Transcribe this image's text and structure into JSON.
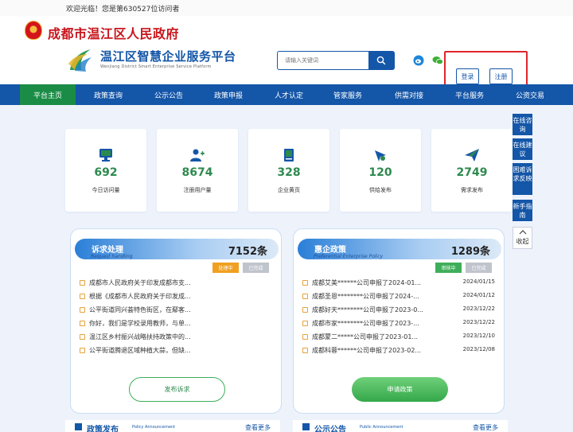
{
  "topbar": {
    "welcome": "欢迎光临！您是第630527位访问者"
  },
  "header": {
    "gov_title": "成都市温江区人民政府",
    "platform_title": "温江区智慧企业服务平台",
    "platform_subtitle": "Wenjiang District Smart Enterprise Service Platform",
    "search_placeholder": "请输入关键词",
    "login_label": "登录",
    "register_label": "注册"
  },
  "nav": {
    "items": [
      {
        "label": "平台主页"
      },
      {
        "label": "政策查询"
      },
      {
        "label": "公示公告"
      },
      {
        "label": "政策申报"
      },
      {
        "label": "人才认定"
      },
      {
        "label": "管家服务"
      },
      {
        "label": "供需对接"
      },
      {
        "label": "平台服务"
      },
      {
        "label": "公资交易"
      }
    ]
  },
  "side_tools": {
    "items": [
      {
        "label": "在线咨询"
      },
      {
        "label": "在线建议"
      },
      {
        "label": "困难诉求反映"
      },
      {
        "label": "新手指南"
      }
    ],
    "collapse_label": "收起"
  },
  "stats": [
    {
      "value": "692",
      "label": "今日访问量",
      "icon": "monitor-icon"
    },
    {
      "value": "8674",
      "label": "注册用户量",
      "icon": "add-user-icon"
    },
    {
      "value": "328",
      "label": "企业黄页",
      "icon": "book-icon"
    },
    {
      "value": "120",
      "label": "供给发布",
      "icon": "supply-icon"
    },
    {
      "value": "2749",
      "label": "需求发布",
      "icon": "paper-plane-icon"
    }
  ],
  "panels": {
    "appeals": {
      "title": "诉求处理",
      "subtitle": "Request handling",
      "count": "7152条",
      "tags": [
        "处理中",
        "已完成"
      ],
      "rows": [
        "成都市人民政府关于印发成都市支...",
        "根据《成都市人民政府关于印发成...",
        "公平街道同兴荟特色街区，在鄢客...",
        "你好，我们是学校录用教师，与单...",
        "温江区乡村振兴战略扶持政策中的...",
        "公平街道腾退区域种植大蒜，但缺..."
      ],
      "button_label": "发布诉求"
    },
    "policy": {
      "title": "惠企政策",
      "subtitle": "Preferential Enterprise Policy",
      "count": "1289条",
      "tags": [
        "审核中",
        "已完成"
      ],
      "rows": [
        {
          "text": "成都艾美******公司申报了2024-01...",
          "date": "2024/01/15"
        },
        {
          "text": "成都圣恩********公司申报了2024-...",
          "date": "2024/01/12"
        },
        {
          "text": "成都好天********公司申报了2023-0...",
          "date": "2023/12/22"
        },
        {
          "text": "成都市家********公司申报了2023-...",
          "date": "2023/12/22"
        },
        {
          "text": "成都蒙二*****公司申报了2023-01...",
          "date": "2023/12/10"
        },
        {
          "text": "成都科蓉******公司申报了2023-02...",
          "date": "2023/12/08"
        }
      ],
      "button_label": "申请政策"
    }
  },
  "bottom": {
    "left_title": "政策发布",
    "left_subtitle": "Policy Announcement",
    "left_more": "查看更多",
    "right_title": "公示公告",
    "right_subtitle": "Public Announcement",
    "right_more": "查看更多"
  },
  "colors": {
    "brand_blue": "#1456a8",
    "nav_active_green": "#1a8c45",
    "gov_red": "#c8161d",
    "stat_green": "#2d8a4e",
    "tag_orange": "#f0a020",
    "tag_gray": "#c0c4cc",
    "tag_green": "#3fae5a",
    "highlight_red": "#e0262b"
  }
}
